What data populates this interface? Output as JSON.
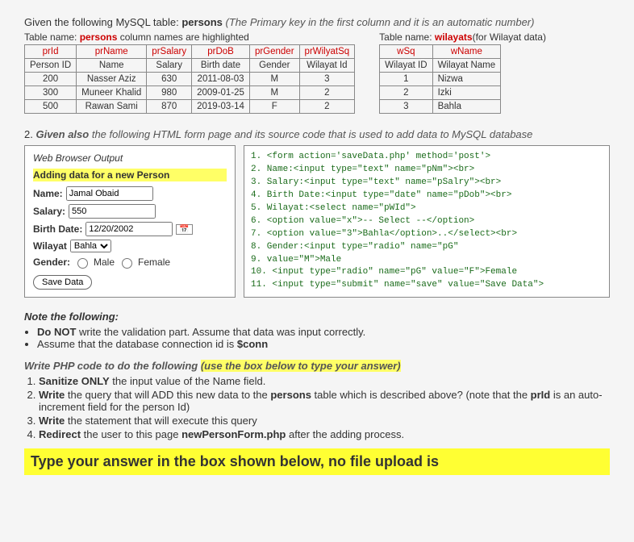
{
  "intro": {
    "prefix": "Given the following MySQL table: ",
    "tablename": "persons ",
    "suffix": "(The Primary key in the first column and it is an automatic number)"
  },
  "personsTable": {
    "caption_prefix": "Table name: ",
    "caption_name": "persons",
    "caption_suffix": "  column names are highlighted",
    "headers": [
      "prId",
      "prName",
      "prSalary",
      "prDoB",
      "prGender",
      "prWilyatSq"
    ],
    "subheaders": [
      "Person ID",
      "Name",
      "Salary",
      "Birth date",
      "Gender",
      "Wilayat Id"
    ],
    "rows": [
      [
        "200",
        "Nasser Aziz",
        "630",
        "2011-08-03",
        "M",
        "3"
      ],
      [
        "300",
        "Muneer Khalid",
        "980",
        "2009-01-25",
        "M",
        "2"
      ],
      [
        "500",
        "Rawan Sami",
        "870",
        "2019-03-14",
        "F",
        "2"
      ]
    ]
  },
  "wilayatsTable": {
    "caption_prefix": "Table name: ",
    "caption_name": "wilayats",
    "caption_suffix": "(for Wilayat data)",
    "headers": [
      "wSq",
      "wName"
    ],
    "subheaders": [
      "Wilayat ID",
      "Wilayat Name"
    ],
    "rows": [
      [
        "1",
        "Nizwa"
      ],
      [
        "2",
        "Izki"
      ],
      [
        "3",
        "Bahla"
      ]
    ]
  },
  "q2_prefix": "2. ",
  "q2_bold": "Given also",
  "q2_suffix": " the following HTML form page and its source code that is used to add data to MySQL database",
  "browser": {
    "title": "Web Browser Output",
    "heading": "Adding data for a new Person",
    "labels": {
      "name": "Name:",
      "salary": "Salary:",
      "birth": "Birth Date:",
      "wilayat": "Wilayat",
      "gender": "Gender:"
    },
    "values": {
      "name": "Jamal Obaid",
      "salary": "550",
      "birth": "12/20/2002",
      "wilayat": "Bahla"
    },
    "genderMale": "Male",
    "genderFemale": "Female",
    "save": "Save Data"
  },
  "code": [
    "1. <form action='saveData.php' method='post'>",
    "2. Name:<input type=\"text\" name=\"pNm\"><br>",
    "3. Salary:<input type=\"text\" name=\"pSalry\"><br>",
    "4. Birth Date:<input type=\"date\" name=\"pDob\"><br>",
    "5. Wilayat:<select name=\"pWId\">",
    "6. <option value=\"x\">-- Select --</option>",
    "7. <option value=\"3\">Bahla</option>..</select><br>",
    "8. Gender:<input type=\"radio\" name=\"pG\"",
    "9. value=\"M\">Male",
    "10. <input type=\"radio\" name=\"pG\" value=\"F\">Female",
    "11. <input type=\"submit\" name=\"save\" value=\"Save Data\">"
  ],
  "notes": {
    "title": "Note the following:",
    "b1_prefix": "Do NOT ",
    "b1_rest": "write the validation part. Assume that data was input correctly.",
    "b2": "Assume that the database connection id is ",
    "b2_var": "$conn"
  },
  "task": {
    "intro_plain": "Write PHP code to do the following ",
    "intro_hl": "(use the box below to type your answer)",
    "t1_b": "Sanitize ONLY",
    "t1_r": " the input value of the Name field.",
    "t2_b": "Write",
    "t2_r": " the query that will ADD this new data to the ",
    "t2_bold2": "persons",
    "t2_r2": " table which is described above? (note that the ",
    "t2_bold3": "prId",
    "t2_r3": " is an auto-increment field for the person Id)",
    "t3_b": "Write",
    "t3_r": " the statement that will execute this query",
    "t4_b": "Redirect",
    "t4_r": " the user to this page ",
    "t4_bold2": "newPersonForm.php",
    "t4_r2": " after the adding process."
  },
  "banner": "Type your answer in the box shown below, no file upload is"
}
